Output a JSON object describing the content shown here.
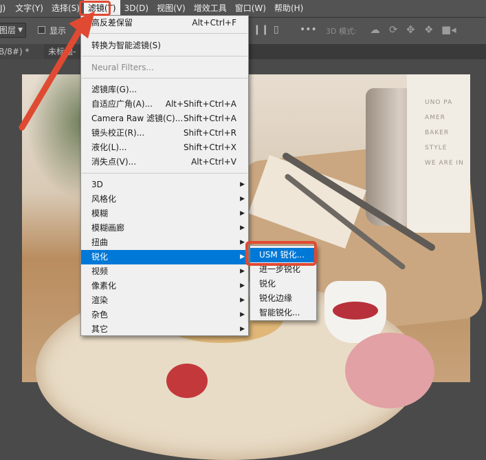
{
  "menubar": {
    "items": [
      "J)",
      "文字(Y)",
      "选择(S)",
      "滤镜(T)",
      "3D(D)",
      "视图(V)",
      "增效工具",
      "窗口(W)",
      "帮助(H)"
    ]
  },
  "options": {
    "layer_select": "图层",
    "show_label": "显示",
    "mode_label": "3D 模式:"
  },
  "tabs": [
    "B/8#) *",
    "未标题-"
  ],
  "filter_menu": {
    "last_filter": {
      "label": "高反差保留",
      "shortcut": "Alt+Ctrl+F"
    },
    "convert_smart": {
      "label": "转换为智能滤镜(S)"
    },
    "neural": {
      "label": "Neural Filters..."
    },
    "gallery": {
      "label": "滤镜库(G)..."
    },
    "adaptive_wide": {
      "label": "自适应广角(A)...",
      "shortcut": "Alt+Shift+Ctrl+A"
    },
    "camera_raw": {
      "label": "Camera Raw 滤镜(C)...",
      "shortcut": "Shift+Ctrl+A"
    },
    "lens_correction": {
      "label": "镜头校正(R)...",
      "shortcut": "Shift+Ctrl+R"
    },
    "liquify": {
      "label": "液化(L)...",
      "shortcut": "Shift+Ctrl+X"
    },
    "vanishing_point": {
      "label": "消失点(V)...",
      "shortcut": "Alt+Ctrl+V"
    },
    "submenus": [
      "3D",
      "风格化",
      "模糊",
      "模糊画廊",
      "扭曲",
      "锐化",
      "视频",
      "像素化",
      "渲染",
      "杂色",
      "其它"
    ]
  },
  "sharpen_submenu": [
    "USM 锐化...",
    "进一步锐化",
    "锐化",
    "锐化边缘",
    "智能锐化..."
  ],
  "photo_sign_text": [
    "UNO PA",
    "AMER",
    "BAKER",
    "STYLE",
    "WE ARE IN"
  ],
  "colors": {
    "highlight": "#0078d7",
    "annotation": "#e04a32"
  }
}
